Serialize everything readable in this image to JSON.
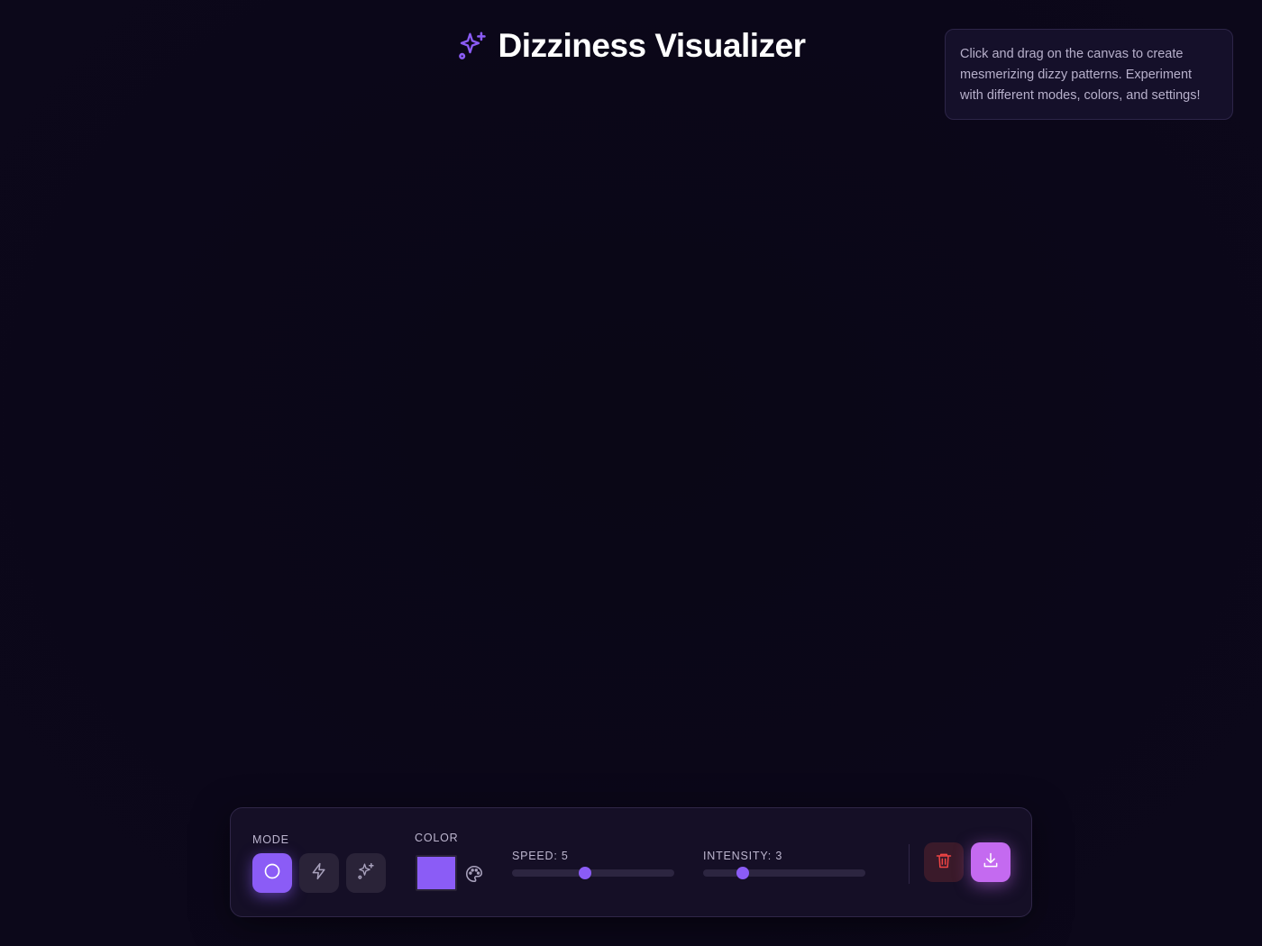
{
  "header": {
    "title": "Dizziness Visualizer",
    "icon": "sparkles-icon",
    "accent": "#8b5cf6"
  },
  "info": {
    "text": "Click and drag on the canvas to create mesmerizing dizzy patterns. Experiment with different modes, colors, and settings!"
  },
  "toolbar": {
    "mode_label": "MODE",
    "modes": [
      {
        "icon": "circle-icon",
        "active": true
      },
      {
        "icon": "zap-icon",
        "active": false
      },
      {
        "icon": "sparkles-icon",
        "active": false
      }
    ],
    "color_label": "COLOR",
    "color_value": "#8b5cf6",
    "speed_label": "SPEED: 5",
    "speed_value": 5,
    "intensity_label": "INTENSITY: 3",
    "intensity_value": 3,
    "clear_icon": "trash-icon",
    "save_icon": "download-icon",
    "clear_color": "#ef4444",
    "save_color": "#c46af0"
  }
}
